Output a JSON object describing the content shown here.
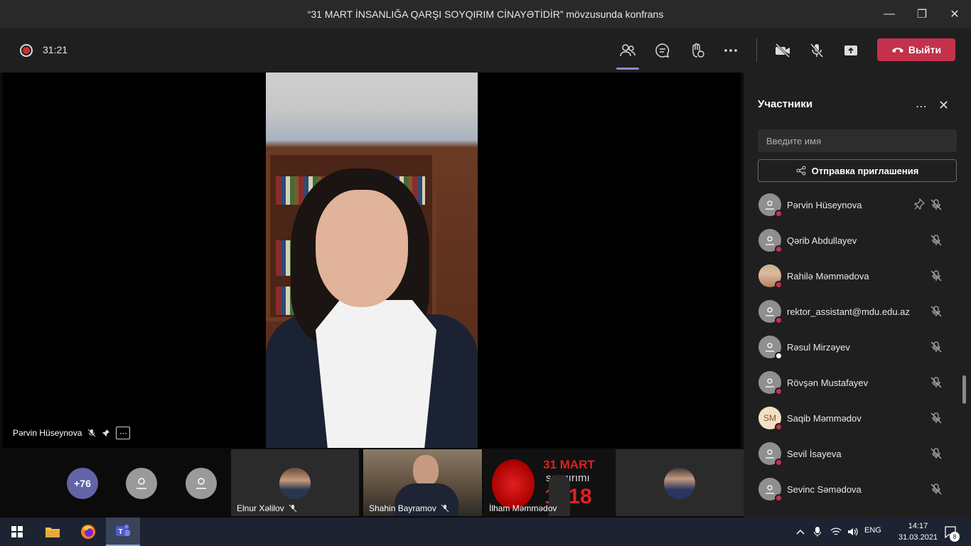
{
  "window": {
    "title": "“31 MART İNSANLIĞA QARŞI SOYQIRIM CİNAYƏTİDİR” mövzusunda konfrans"
  },
  "toolbar": {
    "timer": "31:21",
    "leave_label": "Выйти"
  },
  "stage": {
    "speaker_name": "Pərvin Hüseynova"
  },
  "strip": {
    "overflow_count": "+76",
    "tiles": [
      {
        "name": "Elnur Xəlilov"
      },
      {
        "name": "Shahin Bayramov"
      },
      {
        "name": "İlham Məmmədov"
      }
    ],
    "banner_line1": "31 MART",
    "banner_line2": "soyqırımı",
    "banner_year": "1918"
  },
  "panel": {
    "title": "Участники",
    "search_placeholder": "Введите имя",
    "invite_label": "Отправка приглашения",
    "participants": [
      {
        "name": "Pərvin Hüseynova",
        "initials": "",
        "pinned": true
      },
      {
        "name": "Qərib Abdullayev",
        "initials": ""
      },
      {
        "name": "Rahilə Məmmədova",
        "initials": ""
      },
      {
        "name": "rektor_assistant@mdu.edu.az",
        "initials": ""
      },
      {
        "name": "Rəsul Mirzəyev",
        "initials": ""
      },
      {
        "name": "Rövşən Mustafayev",
        "initials": ""
      },
      {
        "name": "Saqib Məmmədov",
        "initials": "SM"
      },
      {
        "name": "Sevil İsayeva",
        "initials": ""
      },
      {
        "name": "Sevinc Səmədova",
        "initials": ""
      }
    ]
  },
  "taskbar": {
    "lang": "ENG",
    "time": "14:17",
    "date": "31.03.2021",
    "notifications": "8"
  },
  "colors": {
    "accent": "#6264a7",
    "leave": "#c4314b",
    "panel_bg": "#1f1f1f"
  }
}
